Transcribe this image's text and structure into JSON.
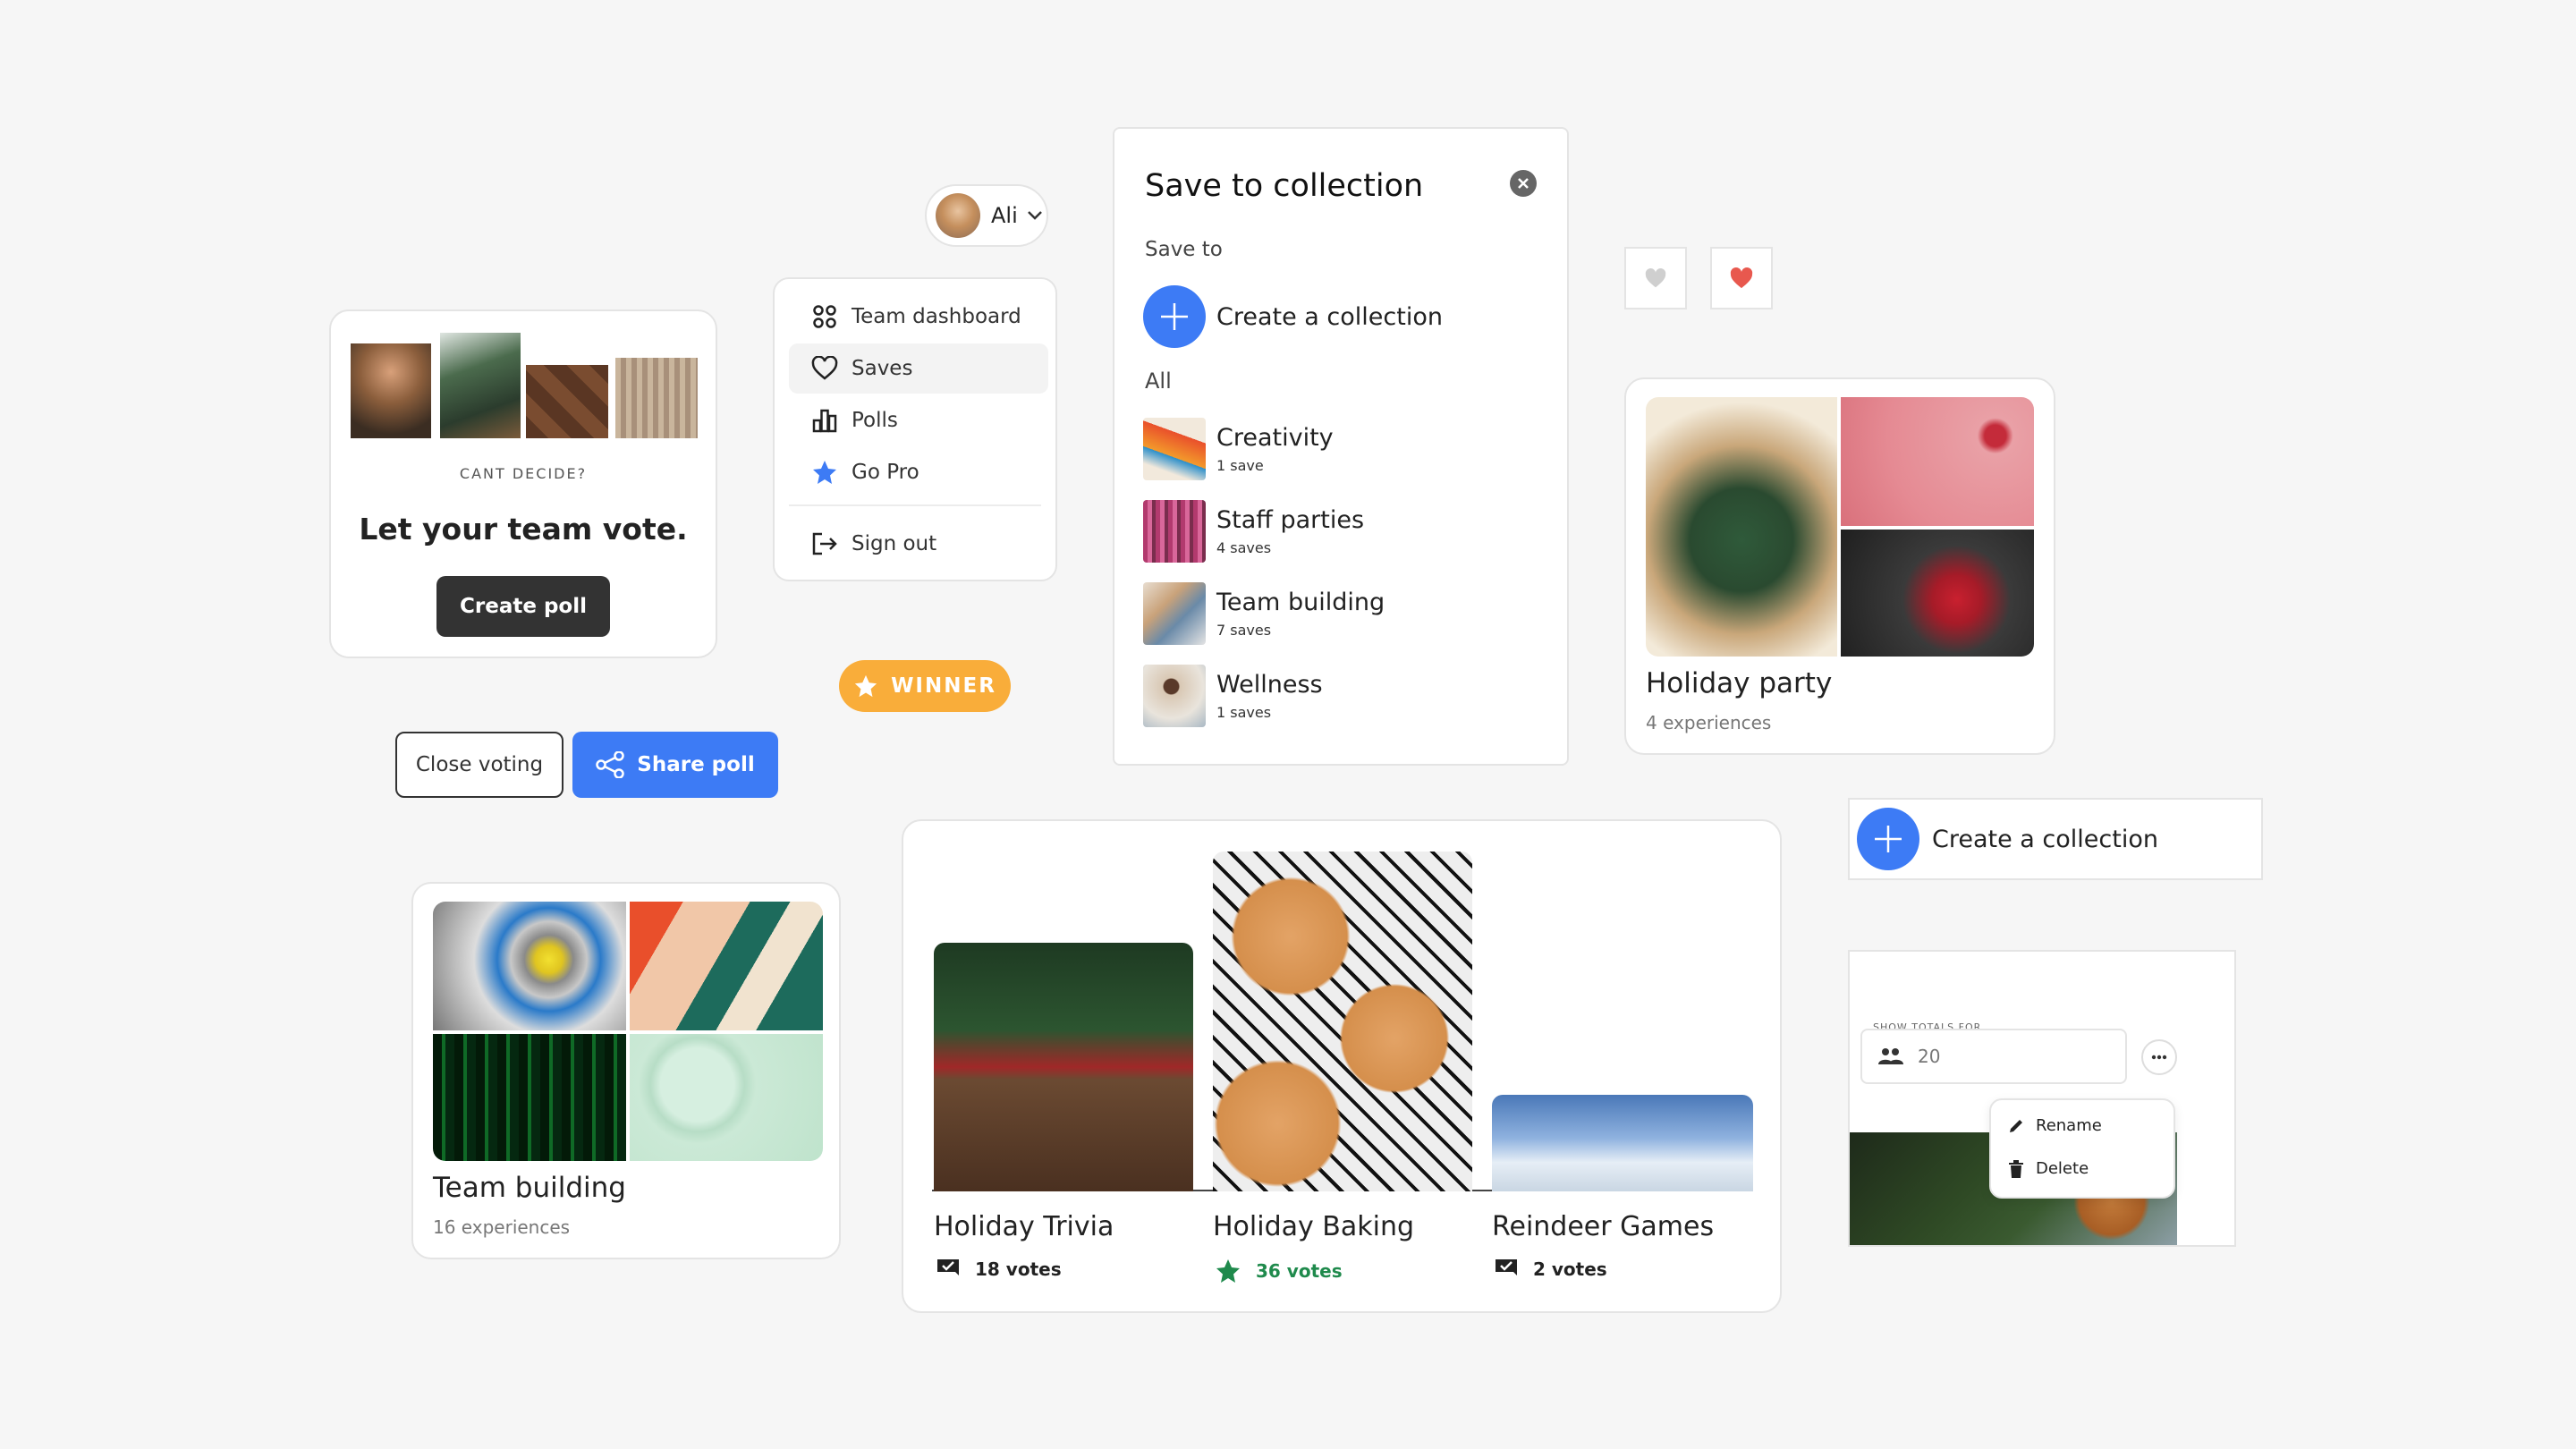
{
  "poll_promo": {
    "eyebrow": "CANT DECIDE?",
    "headline": "Let your team vote.",
    "create_poll_label": "Create poll"
  },
  "profile": {
    "name": "Ali"
  },
  "user_menu": {
    "items": [
      {
        "label": "Team dashboard",
        "icon": "grid-icon"
      },
      {
        "label": "Saves",
        "icon": "heart-icon"
      },
      {
        "label": "Polls",
        "icon": "bar-chart-icon"
      },
      {
        "label": "Go Pro",
        "icon": "star-icon"
      }
    ],
    "sign_out_label": "Sign out"
  },
  "winner_badge": {
    "label": "WINNER"
  },
  "poll_actions": {
    "close_label": "Close voting",
    "share_label": "Share poll"
  },
  "save_modal": {
    "title": "Save to collection",
    "save_to_label": "Save to",
    "create_label": "Create a collection",
    "all_label": "All",
    "collections": [
      {
        "name": "Creativity",
        "count": "1 save"
      },
      {
        "name": "Staff parties",
        "count": "4 saves"
      },
      {
        "name": "Team building",
        "count": "7 saves"
      },
      {
        "name": "Wellness",
        "count": "1 saves"
      }
    ]
  },
  "colors": {
    "accent_blue": "#3d7bf5",
    "winner_orange": "#f9ad3a",
    "heart_red": "#e8584e",
    "dark_button": "#333333"
  },
  "holiday_party": {
    "title": "Holiday party",
    "subtitle": "4 experiences"
  },
  "create_collection_button": {
    "label": "Create a collection"
  },
  "team_building": {
    "title": "Team building",
    "subtitle": "16 experiences"
  },
  "poll_results": {
    "options": [
      {
        "title": "Holiday Trivia",
        "votes": "18 votes",
        "icon": "ballot-icon"
      },
      {
        "title": "Holiday Baking",
        "votes": "36 votes",
        "icon": "star-icon"
      },
      {
        "title": "Reindeer Games",
        "votes": "2 votes",
        "icon": "ballot-icon"
      }
    ]
  },
  "totals_panel": {
    "label": "SHOW TOTALS FOR...",
    "value": "20",
    "rename_label": "Rename",
    "delete_label": "Delete"
  }
}
